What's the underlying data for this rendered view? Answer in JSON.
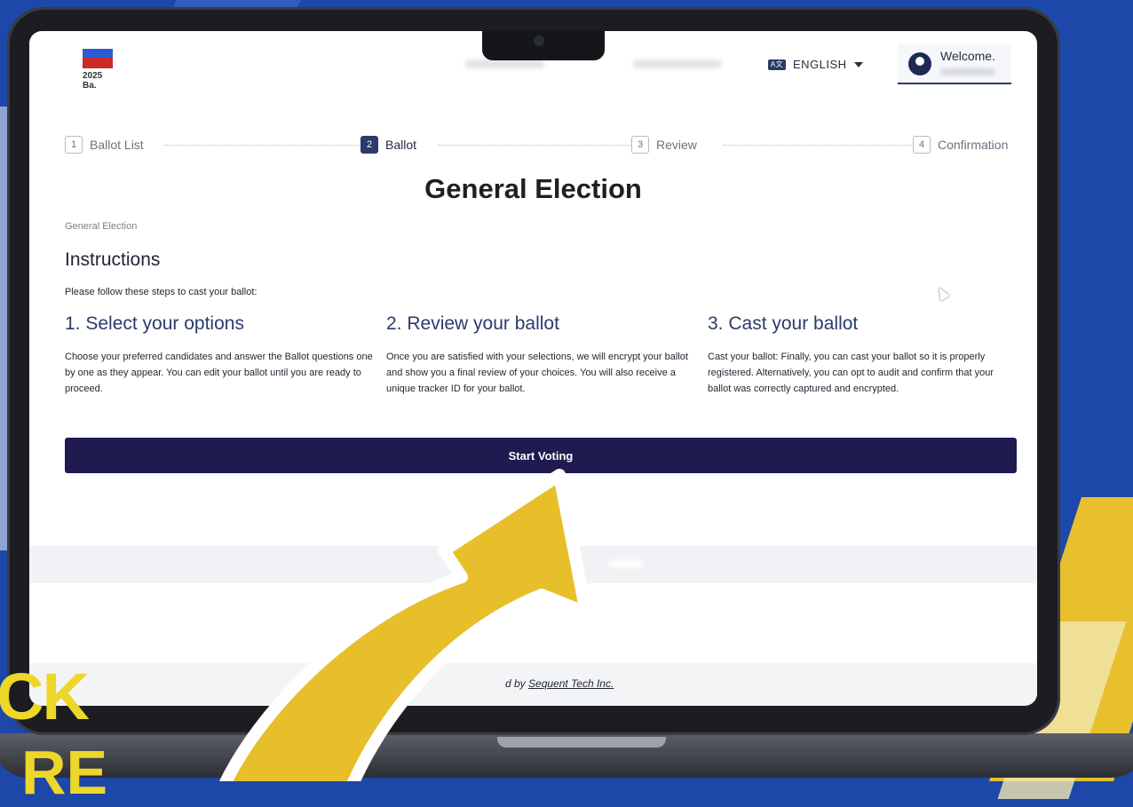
{
  "header": {
    "logo_year": "2025 Ba.",
    "language_label": "ENGLISH",
    "language_icon": "language-icon",
    "welcome_text": "Welcome."
  },
  "stepper": {
    "steps": [
      {
        "num": "1",
        "label": "Ballot List"
      },
      {
        "num": "2",
        "label": "Ballot"
      },
      {
        "num": "3",
        "label": "Review"
      },
      {
        "num": "4",
        "label": "Confirmation"
      }
    ],
    "active_index": 1
  },
  "page": {
    "title": "General Election",
    "breadcrumb": "General Election",
    "instructions_heading": "Instructions",
    "instructions_intro": "Please follow these steps to cast your ballot:",
    "steps": [
      {
        "heading": "1. Select your options",
        "text": "Choose your preferred candidates and answer the Ballot questions one by one as they appear. You can edit your ballot until you are ready to proceed."
      },
      {
        "heading": "2. Review your ballot",
        "text": "Once you are satisfied with your selections, we will encrypt your ballot and show you a final review of your choices. You will also receive a unique tracker ID for your ballot."
      },
      {
        "heading": "3. Cast your ballot",
        "text": "Cast your ballot: Finally, you can cast your ballot so it is properly registered. Alternatively, you can opt to audit and confirm that your ballot was correctly captured and encrypted."
      }
    ],
    "start_button": "Start Voting"
  },
  "footer": {
    "prefix": "d by ",
    "link_text": "Sequent Tech Inc."
  },
  "overlay": {
    "text_line1": "CK",
    "text_line2": "RE"
  },
  "colors": {
    "primary": "#1f1a4f",
    "accent": "#2b3b6a",
    "highlight": "#e7bf2b"
  }
}
